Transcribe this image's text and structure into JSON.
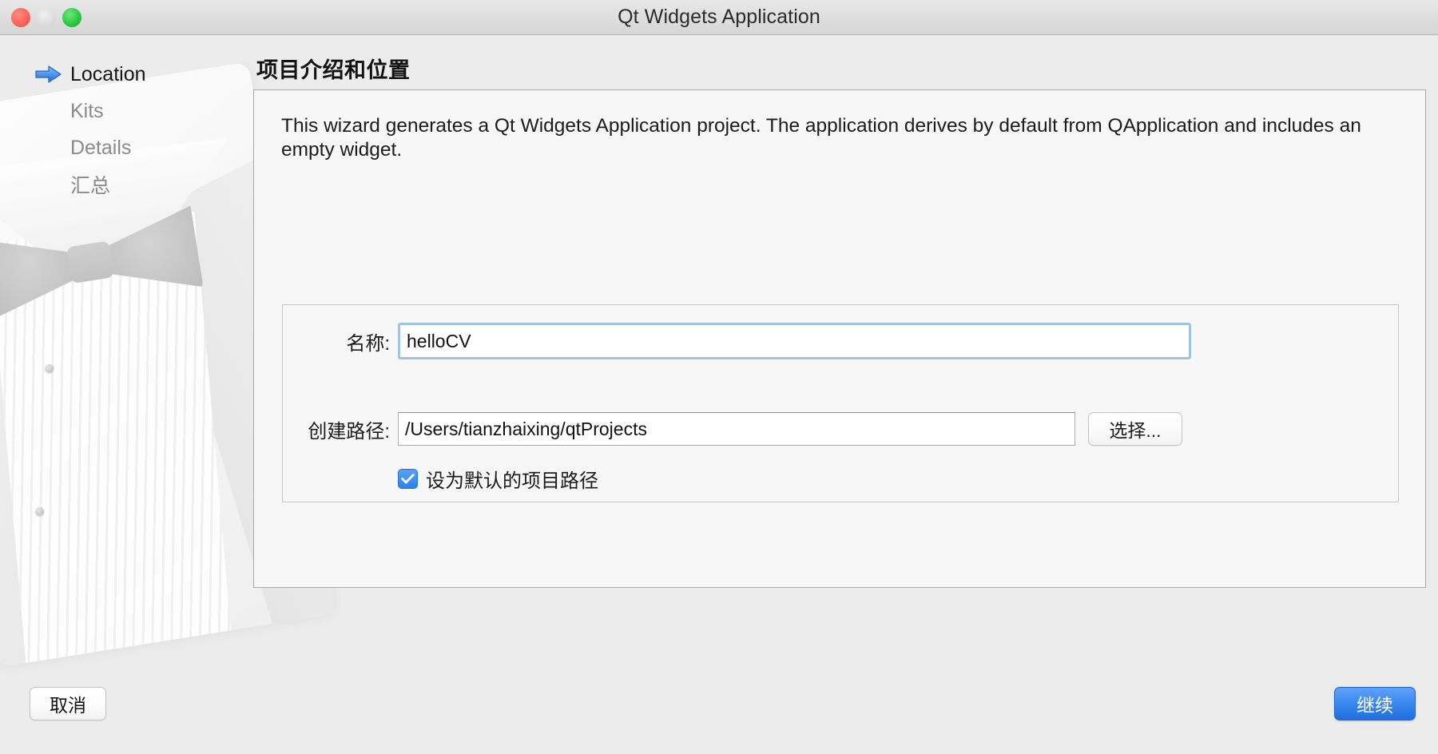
{
  "window": {
    "title": "Qt Widgets Application",
    "traffic_lights": [
      {
        "name": "close",
        "color": "#ff6159"
      },
      {
        "name": "minimize",
        "color": "#dddddd"
      },
      {
        "name": "zoom",
        "color": "#28c840"
      }
    ]
  },
  "sidebar": {
    "items": [
      {
        "label": "Location",
        "icon": "blue-arrow-icon",
        "active": true
      },
      {
        "label": "Kits",
        "icon": "",
        "active": false
      },
      {
        "label": "Details",
        "icon": "",
        "active": false
      },
      {
        "label": "汇总",
        "icon": "",
        "active": false
      }
    ]
  },
  "main": {
    "page_title": "项目介绍和位置",
    "intro": "This wizard generates a Qt Widgets Application project. The application derives by default from QApplication and includes an empty widget.",
    "form": {
      "name_label": "名称:",
      "name_value": "helloCV",
      "path_label": "创建路径:",
      "path_value": "/Users/tianzhaixing/qtProjects",
      "choose_button": "选择...",
      "default_path_checkbox_label": "设为默认的项目路径",
      "default_path_checked": true
    }
  },
  "footer": {
    "cancel_button": "取消",
    "continue_button": "继续"
  },
  "colors": {
    "accent_blue": "#3b89f0",
    "focus_ring": "#9ec3e3",
    "checkbox_blue": "#2f80ea",
    "window_bg": "#ececec",
    "panel_bg": "#f7f7f7"
  }
}
